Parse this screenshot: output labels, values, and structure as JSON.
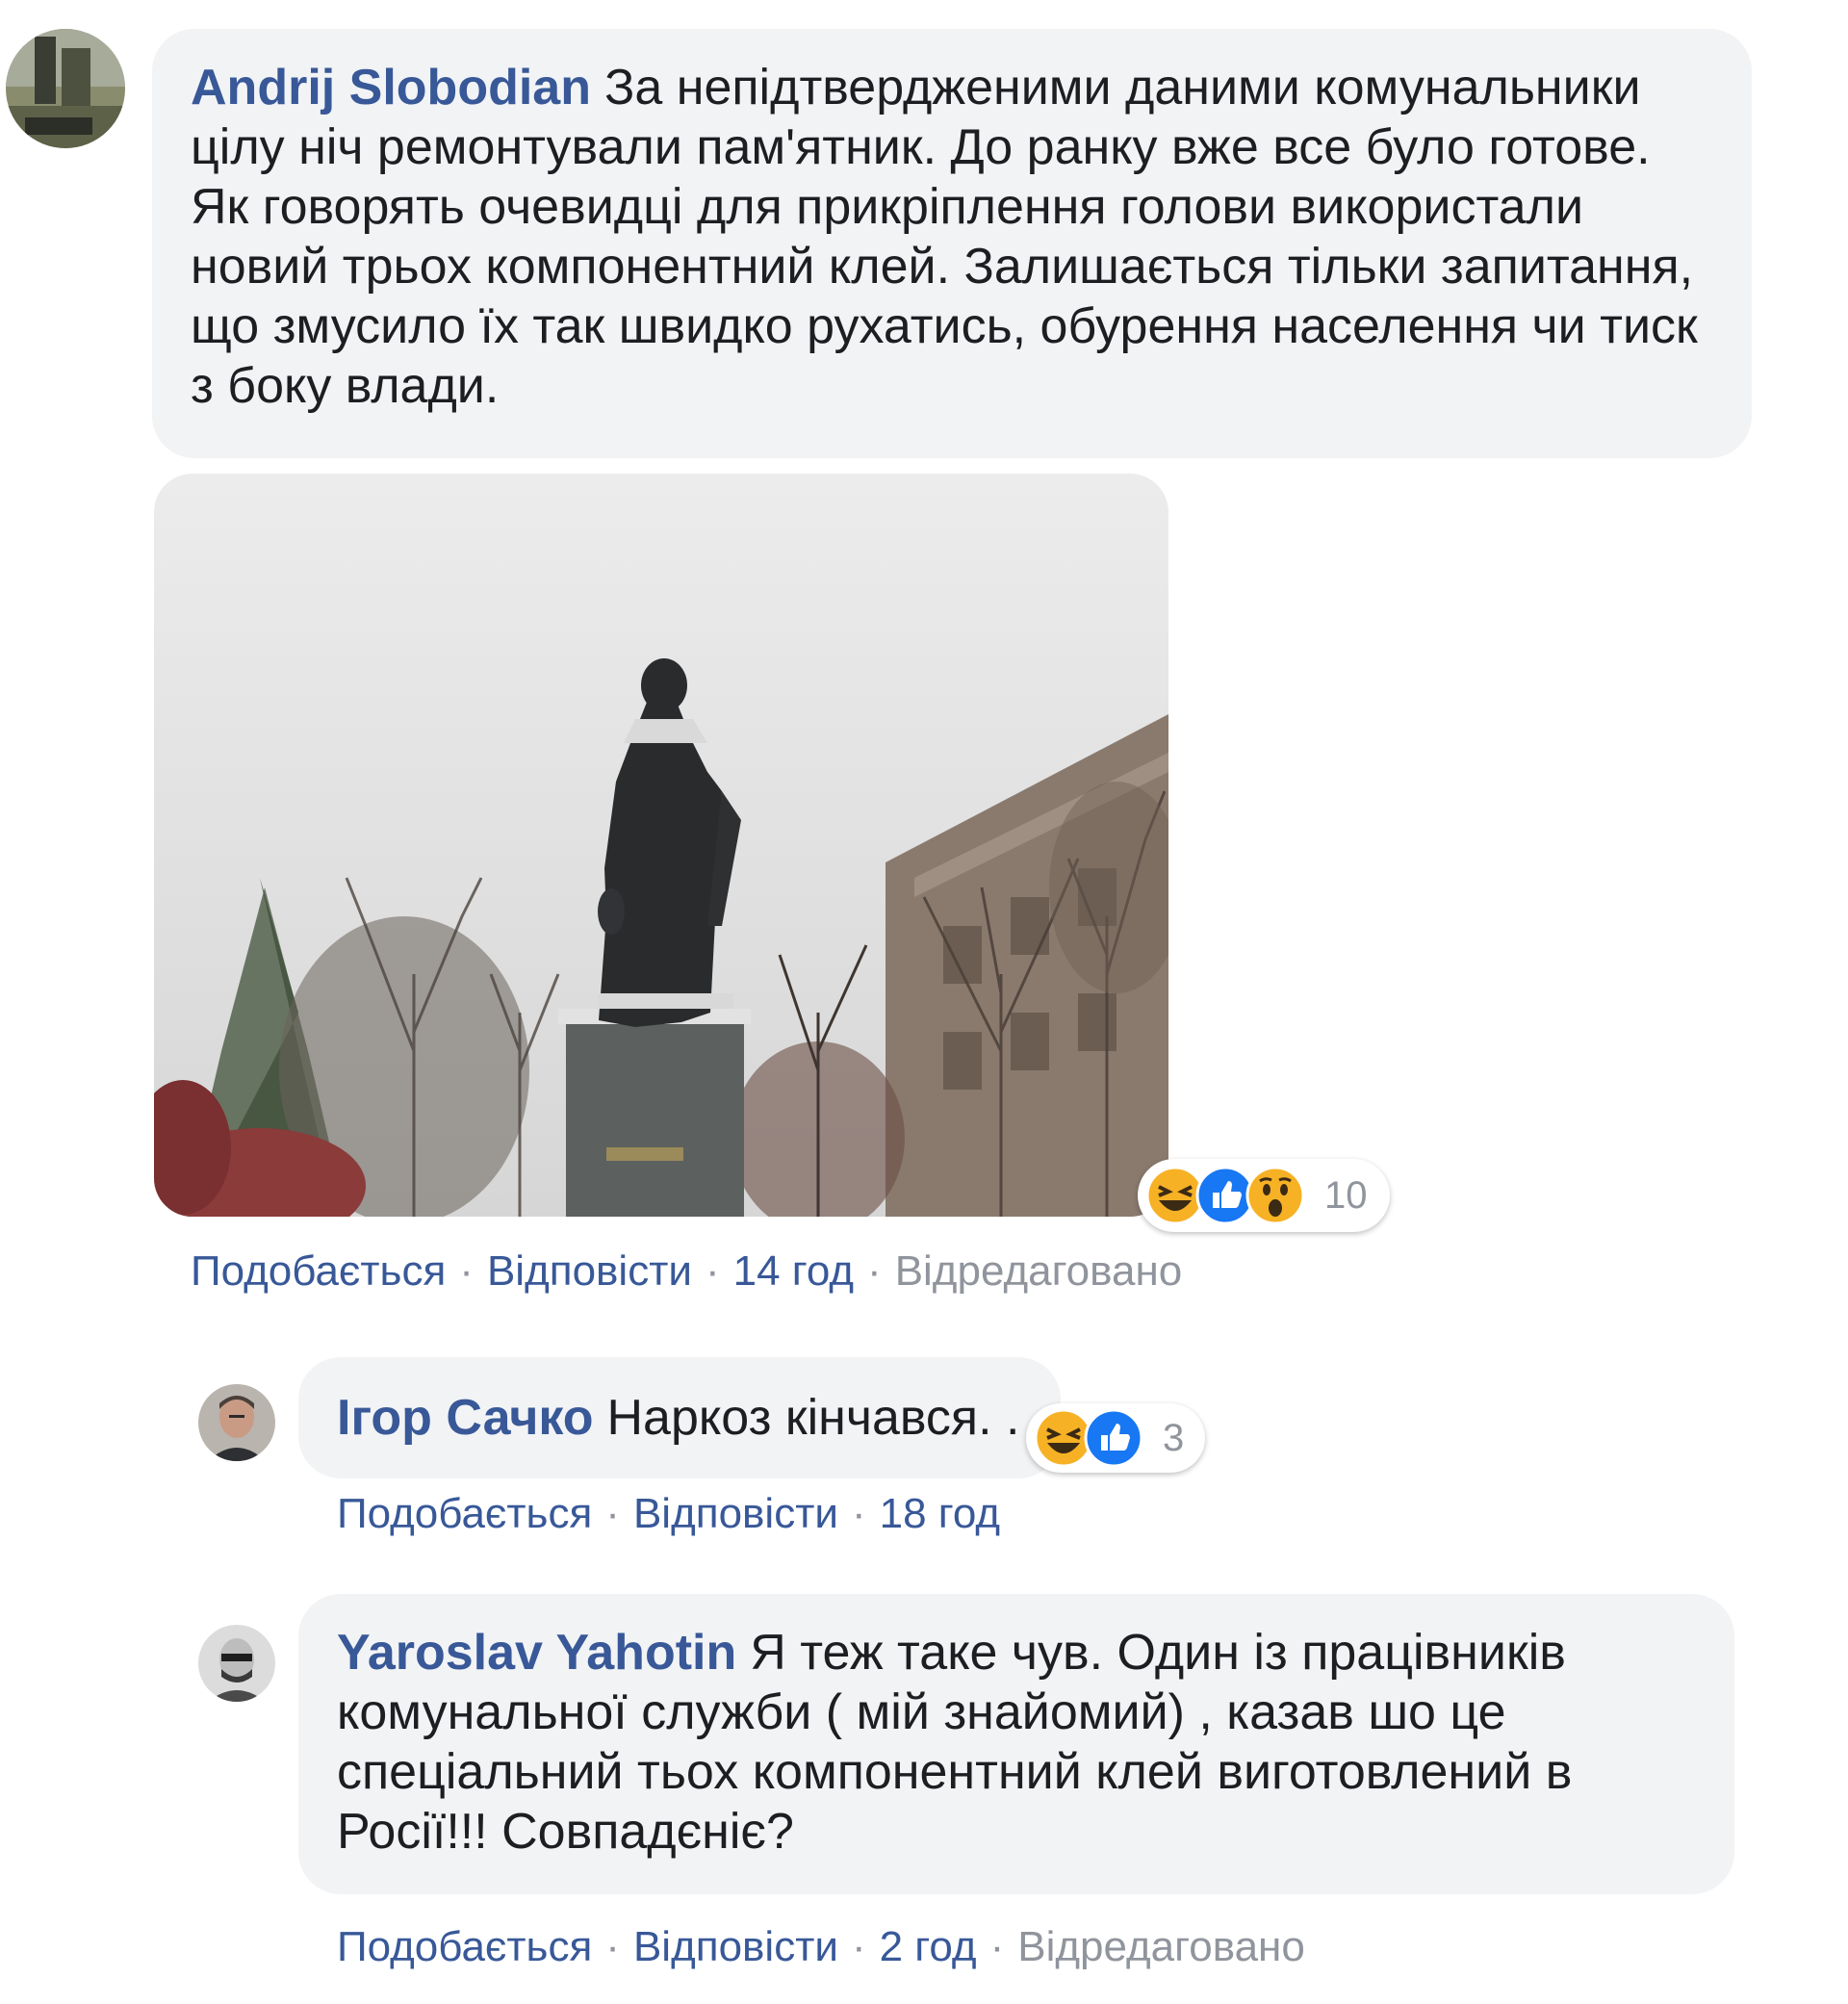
{
  "comments": [
    {
      "author": "Andrij Slobodian",
      "text": "За непідтвердженими даними комунальники цілу ніч ремонтували пам'ятник. До ранку вже все було готове. Як говорять очевидці для прикріплення голови використали новий трьох компонентний клей. Залишається тільки запитання, що змусило їх так швидко рухатись, обурення населення чи тиск з боку влади.",
      "reaction_count": "10",
      "reaction_icons": [
        "haha-icon",
        "like-icon",
        "wow-icon"
      ],
      "like": "Подобається",
      "reply": "Відповісти",
      "time": "14 год",
      "edited": "Відредаговано"
    },
    {
      "author": "Ігор Сачко",
      "text": "Наркоз кінчався. .",
      "reaction_count": "3",
      "reaction_icons": [
        "haha-icon",
        "like-icon"
      ],
      "like": "Подобається",
      "reply": "Відповісти",
      "time": "18 год"
    },
    {
      "author": "Yaroslav Yahotin",
      "text": "Я теж таке чув. Один із працівників комунальної служби ( мій знайомий) , казав шо це спеціальний тьох компонентний клей виготовлений в Росії!!! Совпадєніє?",
      "like": "Подобається",
      "reply": "Відповісти",
      "time": "2 год",
      "edited": "Відредаговано"
    }
  ],
  "colors": {
    "author": "#385898",
    "bubble": "#f2f3f5",
    "meta": "#606770",
    "like_blue": "#1877f2",
    "haha_yellow": "#f7b125"
  }
}
